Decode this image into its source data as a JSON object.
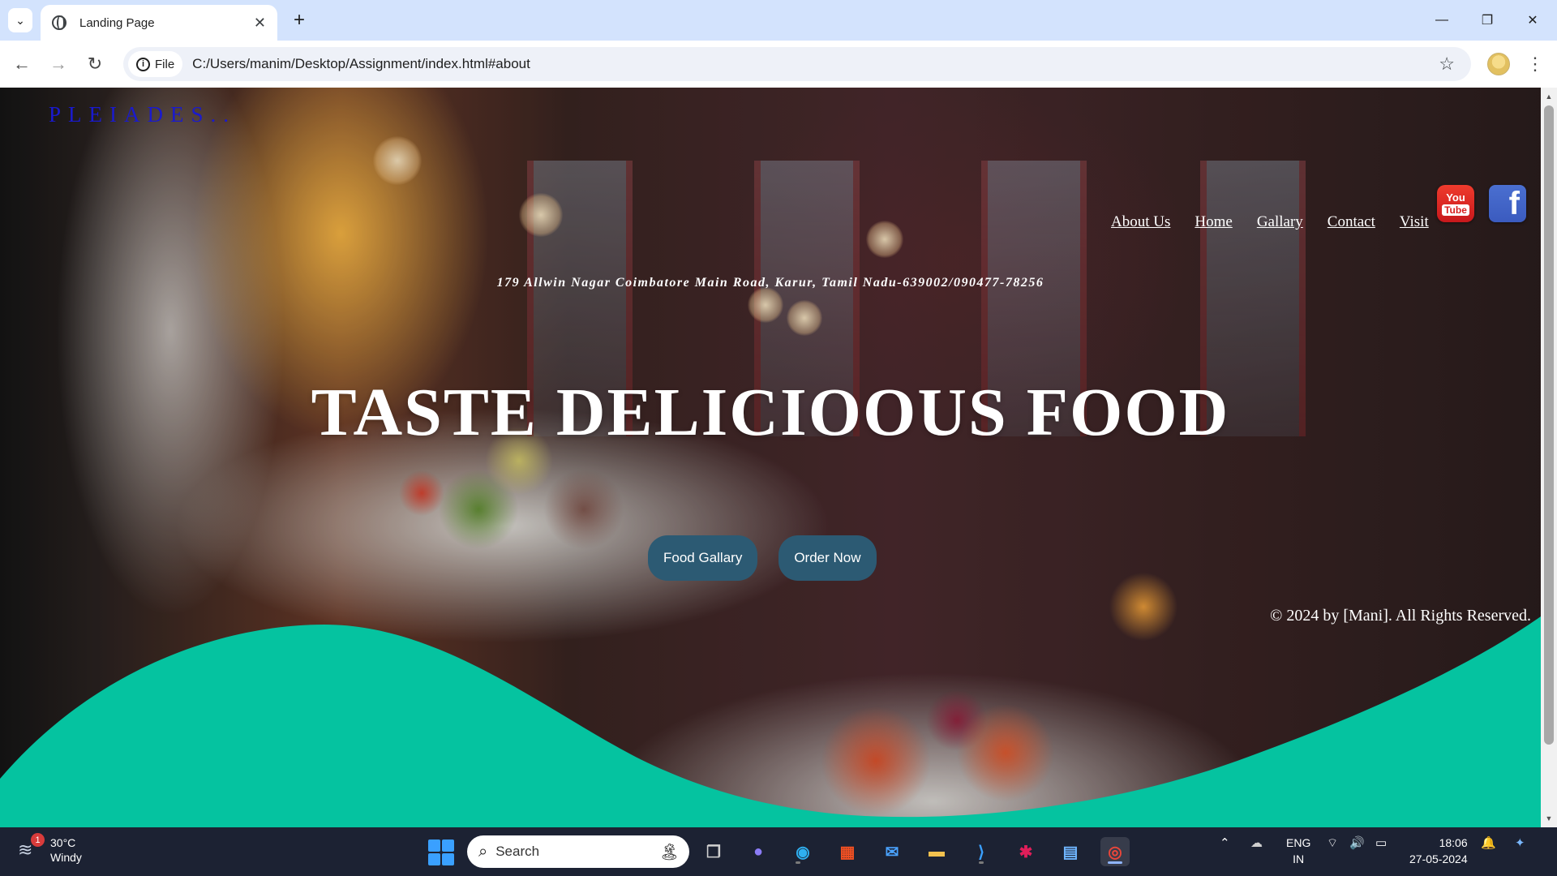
{
  "browser": {
    "tab_title": "Landing Page",
    "new_tab_label": "+",
    "site_chip_label": "File",
    "url": "C:/Users/manim/Desktop/Assignment/index.html#about"
  },
  "page": {
    "brand": "PLEIADES..",
    "nav": [
      {
        "label": "About Us"
      },
      {
        "label": "Home"
      },
      {
        "label": "Gallary"
      },
      {
        "label": "Contact"
      },
      {
        "label": "Visit"
      }
    ],
    "social": {
      "youtube_you": "You",
      "youtube_tube": "Tube",
      "facebook": "f"
    },
    "address": "179 Allwin Nagar Coimbatore Main Road, Karur, Tamil Nadu-639002/090477-78256",
    "headline": "TASTE DELICIOOUS FOOD",
    "buttons": {
      "food_gallery": "Food Gallary",
      "order_now": "Order Now"
    },
    "copyright": "© 2024 by [Mani]. All Rights Reserved.",
    "accent_wave_color": "#05c3a0",
    "button_color": "#2c5a73",
    "brand_color": "#1a1acd"
  },
  "taskbar": {
    "weather_temp": "30°C",
    "weather_desc": "Windy",
    "weather_badge": "1",
    "search_placeholder": "Search",
    "lang_line1": "ENG",
    "lang_line2": "IN",
    "time": "18:06",
    "date": "27-05-2024"
  }
}
